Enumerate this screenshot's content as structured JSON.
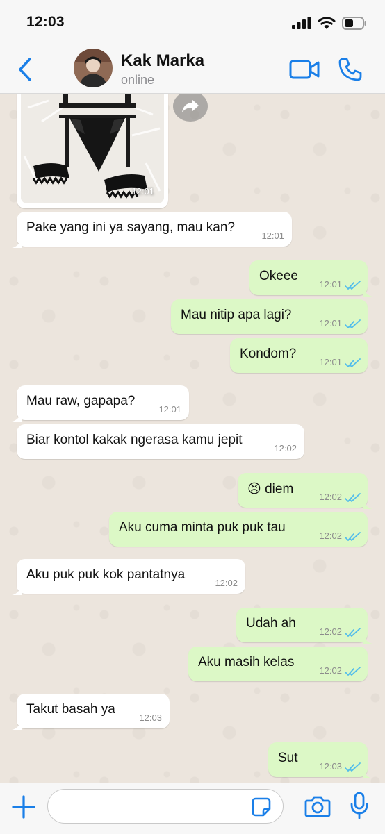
{
  "status_bar": {
    "time": "12:03"
  },
  "header": {
    "back_icon": "chevron-left-icon",
    "contact_name": "Kak Marka",
    "contact_status": "online",
    "video_icon": "video-camera-icon",
    "call_icon": "phone-icon"
  },
  "colors": {
    "accent": "#1a7fe8",
    "incoming_bubble": "#ffffff",
    "outgoing_bubble": "#dcf8c6",
    "read_ticks": "#53bdeb"
  },
  "image_message": {
    "time": "12:01",
    "forward_icon": "forward-arrow-icon"
  },
  "messages": [
    {
      "direction": "in",
      "text": "Pake yang ini ya sayang, mau kan?",
      "time": "12:01"
    },
    {
      "direction": "out",
      "text": "Okeee",
      "time": "12:01",
      "status": "read"
    },
    {
      "direction": "out",
      "text": "Mau nitip apa lagi?",
      "time": "12:01",
      "status": "read"
    },
    {
      "direction": "out",
      "text": "Kondom?",
      "time": "12:01",
      "status": "read"
    },
    {
      "direction": "in",
      "text": "Mau raw, gapapa?",
      "time": "12:01"
    },
    {
      "direction": "in",
      "text": "Biar kontol kakak ngerasa kamu jepit",
      "time": "12:02"
    },
    {
      "direction": "out",
      "text": "😣 diem",
      "time": "12:02",
      "status": "read"
    },
    {
      "direction": "out",
      "text": "Aku cuma minta puk puk tau",
      "time": "12:02",
      "status": "read"
    },
    {
      "direction": "in",
      "text": "Aku puk puk kok pantatnya",
      "time": "12:02"
    },
    {
      "direction": "out",
      "text": "Udah ah",
      "time": "12:02",
      "status": "read"
    },
    {
      "direction": "out",
      "text": "Aku masih kelas",
      "time": "12:02",
      "status": "read"
    },
    {
      "direction": "in",
      "text": "Takut basah ya",
      "time": "12:03"
    },
    {
      "direction": "out",
      "text": "Sut",
      "time": "12:03",
      "status": "read"
    }
  ],
  "input_bar": {
    "plus_icon": "plus-icon",
    "input_value": "",
    "sticker_icon": "sticker-icon",
    "camera_icon": "camera-icon",
    "mic_icon": "microphone-icon"
  }
}
